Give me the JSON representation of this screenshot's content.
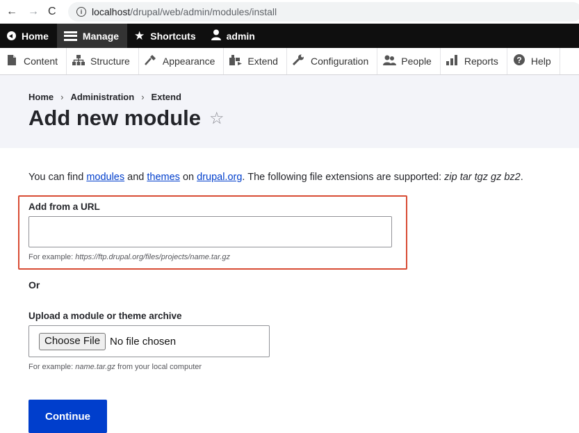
{
  "browser": {
    "url_host": "localhost",
    "url_path": "/drupal/web/admin/modules/install"
  },
  "toolbar": {
    "items": [
      {
        "label": "Home",
        "icon": "back-circle-icon"
      },
      {
        "label": "Manage",
        "icon": "hamburger-icon"
      },
      {
        "label": "Shortcuts",
        "icon": "star-icon"
      },
      {
        "label": "admin",
        "icon": "user-icon"
      }
    ]
  },
  "tray": {
    "items": [
      {
        "label": "Content",
        "icon": "content-icon"
      },
      {
        "label": "Structure",
        "icon": "structure-icon"
      },
      {
        "label": "Appearance",
        "icon": "appearance-icon"
      },
      {
        "label": "Extend",
        "icon": "extend-icon"
      },
      {
        "label": "Configuration",
        "icon": "wrench-icon"
      },
      {
        "label": "People",
        "icon": "people-icon"
      },
      {
        "label": "Reports",
        "icon": "reports-icon"
      },
      {
        "label": "Help",
        "icon": "help-icon"
      }
    ]
  },
  "breadcrumb": [
    "Home",
    "Administration",
    "Extend"
  ],
  "page": {
    "title": "Add new module",
    "star": "☆"
  },
  "intro": {
    "p1": "You can find ",
    "link_modules": "modules",
    "p2": " and ",
    "link_themes": "themes",
    "p3": " on ",
    "link_drupal": "drupal.org",
    "p4": ". The following file extensions are supported: ",
    "extensions": "zip tar tgz gz bz2",
    "p5": "."
  },
  "url_field": {
    "label": "Add from a URL",
    "value": "",
    "desc_prefix": "For example: ",
    "desc_example": "https://ftp.drupal.org/files/projects/name.tar.gz"
  },
  "or_label": "Or",
  "upload_field": {
    "label": "Upload a module or theme archive",
    "button": "Choose File",
    "status": "No file chosen",
    "desc_prefix": "For example: ",
    "desc_example": "name.tar.gz",
    "desc_suffix": " from your local computer"
  },
  "continue_label": "Continue",
  "colors": {
    "toolbar": "#0f0f0f",
    "primary": "#003ecc",
    "highlight": "#d84b33",
    "header_bg": "#f3f4f9"
  }
}
